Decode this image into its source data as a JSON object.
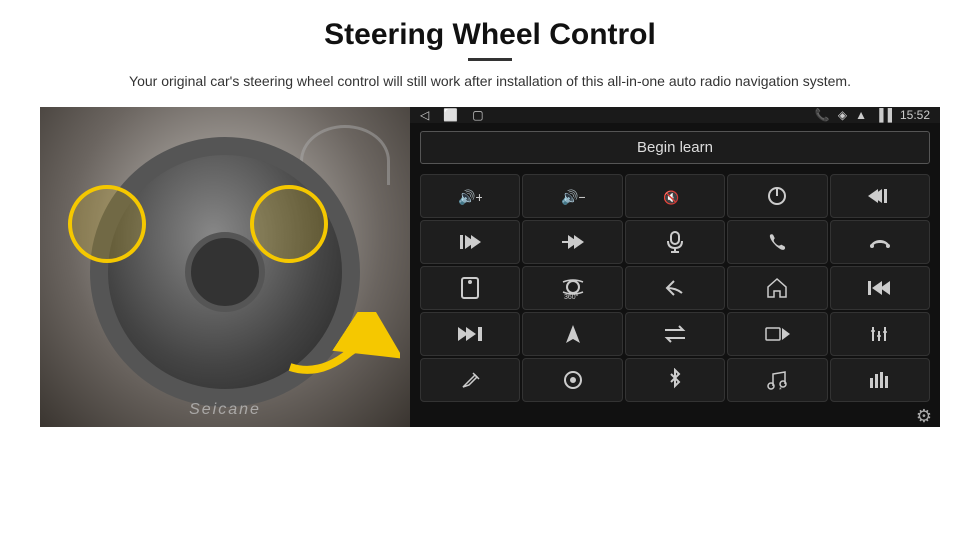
{
  "header": {
    "title": "Steering Wheel Control",
    "subtitle": "Your original car's steering wheel control will still work after installation of this all-in-one auto radio navigation system."
  },
  "status_bar": {
    "time": "15:52",
    "nav_icons": [
      "◁",
      "⬜",
      "▢"
    ]
  },
  "begin_learn": {
    "label": "Begin learn"
  },
  "grid_buttons": [
    {
      "icon": "🔊+",
      "label": "vol-up"
    },
    {
      "icon": "🔊−",
      "label": "vol-down"
    },
    {
      "icon": "🔇",
      "label": "mute"
    },
    {
      "icon": "⏻",
      "label": "power"
    },
    {
      "icon": "⏮",
      "label": "prev-track"
    },
    {
      "icon": "⏭|",
      "label": "next"
    },
    {
      "icon": "⏩⏭",
      "label": "fast-fwd"
    },
    {
      "icon": "🎤",
      "label": "mic"
    },
    {
      "icon": "📞",
      "label": "phone"
    },
    {
      "icon": "↩",
      "label": "hang-up"
    },
    {
      "icon": "📱",
      "label": "app"
    },
    {
      "icon": "360°",
      "label": "camera"
    },
    {
      "icon": "↩",
      "label": "back"
    },
    {
      "icon": "🏠",
      "label": "home"
    },
    {
      "icon": "|◀◀",
      "label": "rewind"
    },
    {
      "icon": "⏭⏭",
      "label": "skip"
    },
    {
      "icon": "▲",
      "label": "nav"
    },
    {
      "icon": "⇄",
      "label": "switch"
    },
    {
      "icon": "🔴",
      "label": "rec"
    },
    {
      "icon": "≡|",
      "label": "eq"
    },
    {
      "icon": "✏",
      "label": "edit"
    },
    {
      "icon": "⊙",
      "label": "circle"
    },
    {
      "icon": "✦",
      "label": "bluetooth"
    },
    {
      "icon": "♪",
      "label": "music"
    },
    {
      "icon": "|||",
      "label": "spectrum"
    }
  ],
  "watermark": "Seicane",
  "settings_icon": "⚙"
}
